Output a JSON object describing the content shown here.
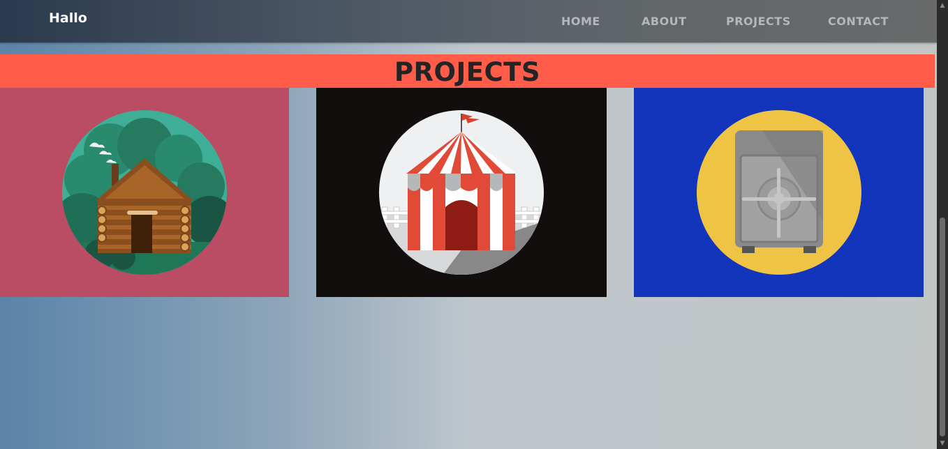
{
  "nav": {
    "brand": "Hallo",
    "links": [
      "HOME",
      "ABOUT",
      "PROJECTS",
      "CONTACT"
    ]
  },
  "section": {
    "title": "PROJECTS"
  },
  "cards": [
    {
      "icon": "log-cabin-icon",
      "background": "#ba4c64"
    },
    {
      "icon": "circus-tent-icon",
      "background": "#110e0d"
    },
    {
      "icon": "safe-icon",
      "background": "#1235bb"
    }
  ],
  "colors": {
    "accent": "#ff5c4a",
    "brand_text": "#ffffff",
    "nav_text": "#b4b8bc"
  },
  "scrollbar": {
    "up": "▲",
    "down": "▼"
  }
}
